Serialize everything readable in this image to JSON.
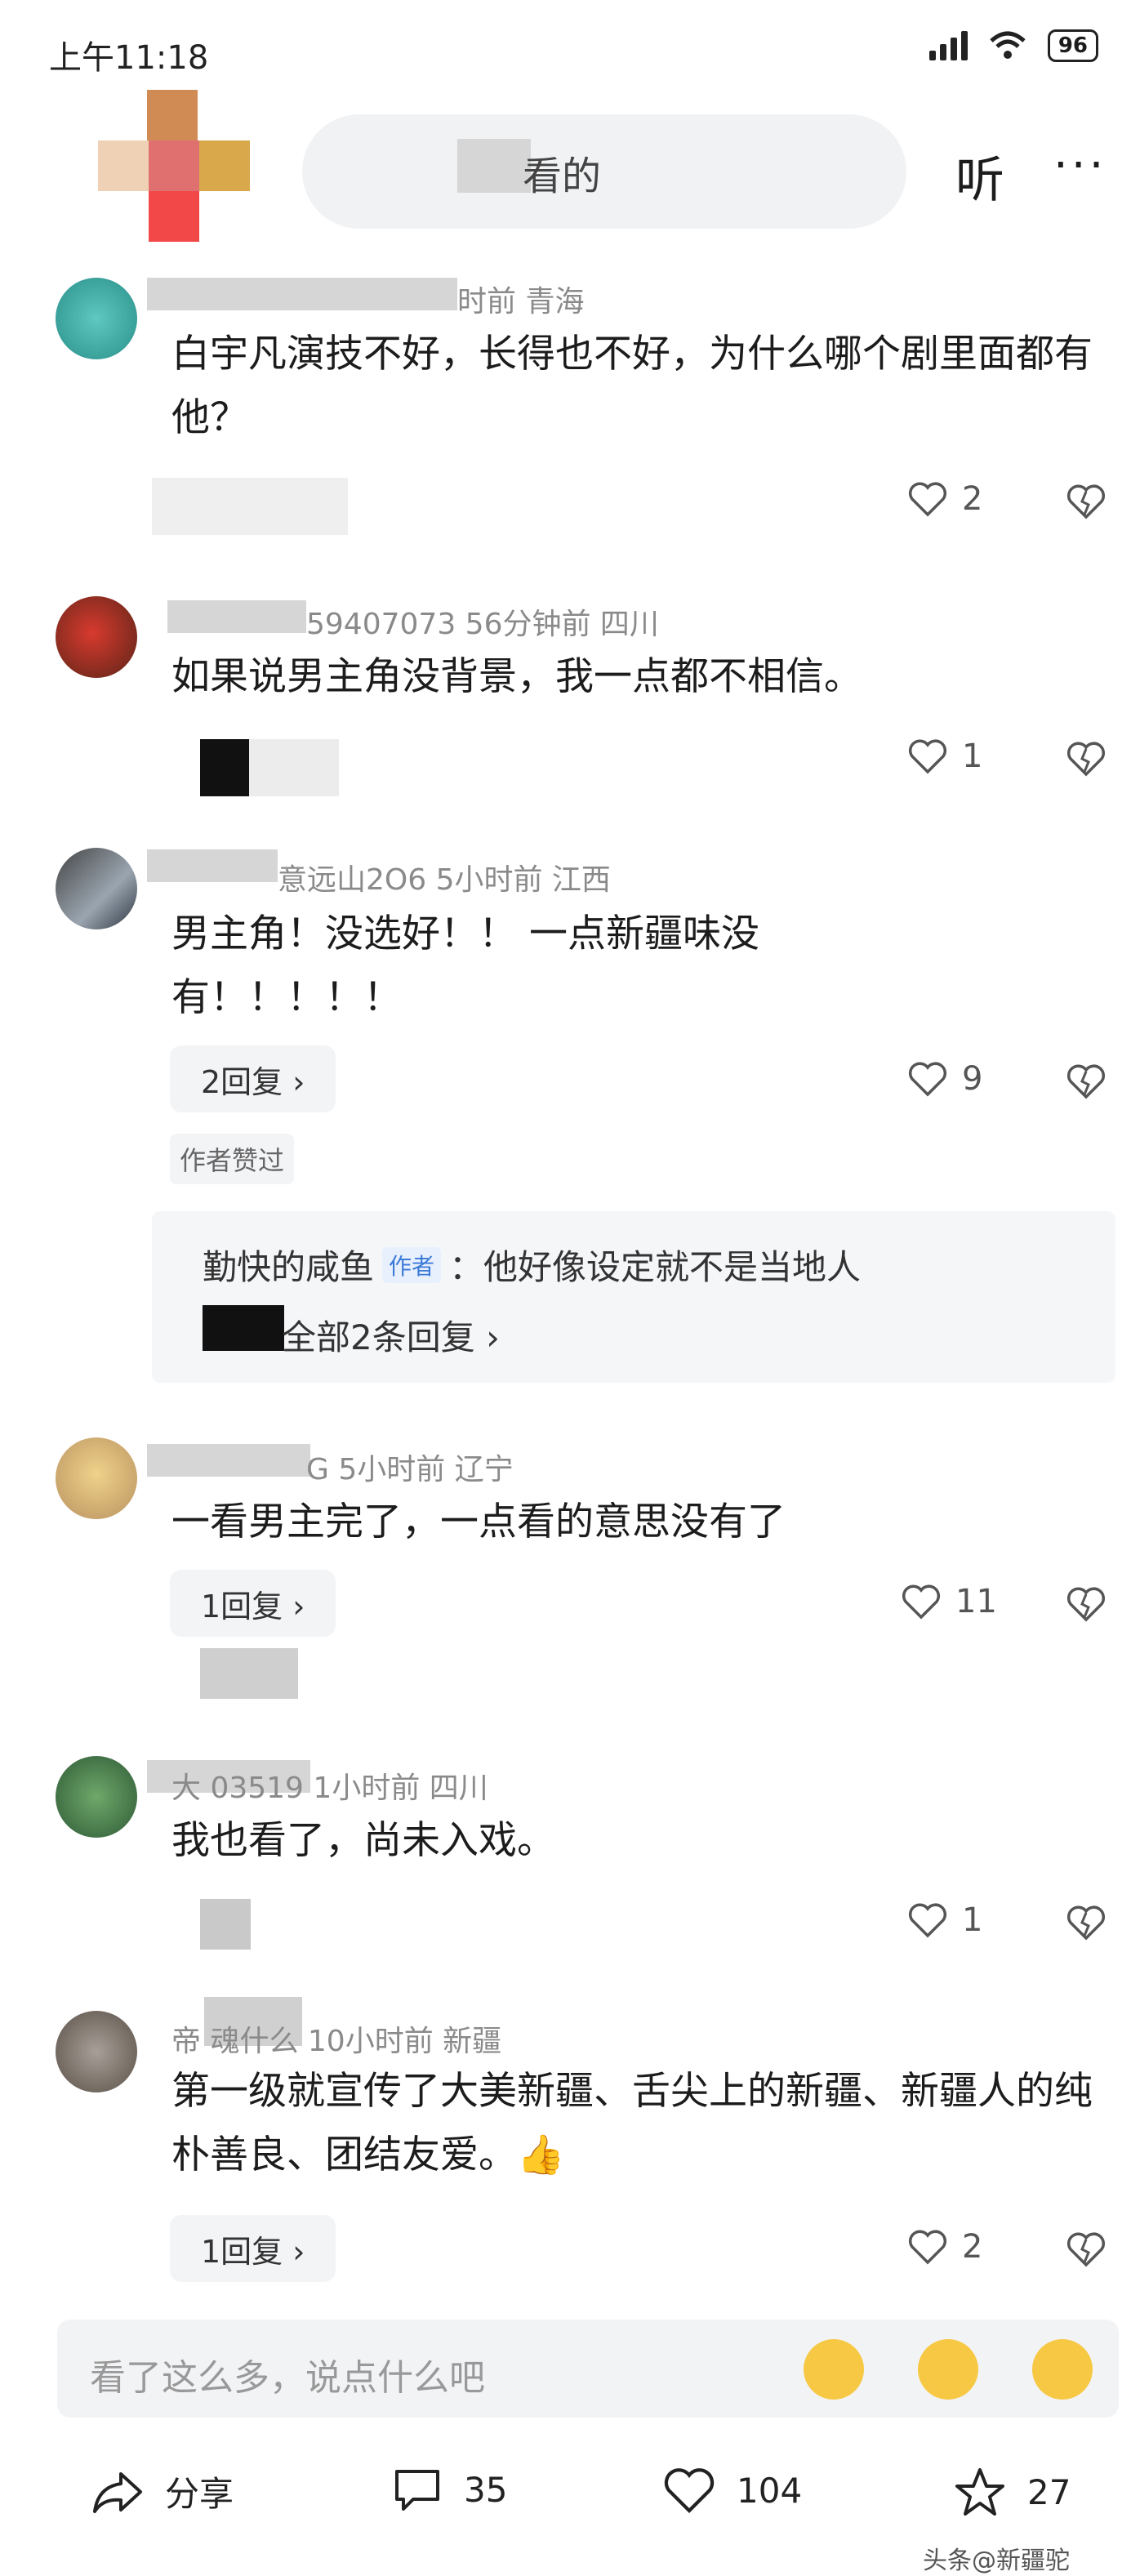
{
  "status_bar": {
    "time": "上午11:18",
    "battery": "96"
  },
  "header": {
    "search_text": "看的",
    "listen_label": "听",
    "more_label": "···"
  },
  "comments": [
    {
      "meta": "时前  青海",
      "text": "白宇凡演技不好，长得也不好，为什么哪个剧里面都有他？",
      "likes": "2"
    },
    {
      "meta": "59407073  56分钟前  四川",
      "text": "如果说男主角没背景，我一点都不相信。",
      "likes": "1"
    },
    {
      "meta": "意远山2O6  5小时前  江西",
      "text": "男主角！没选好！！ 一点新疆味没有！！！！！",
      "likes": "9",
      "reply_button": "2回复 ›",
      "badge": "作者赞过",
      "author_reply": {
        "name": "勤快的咸鱼",
        "tag": "作者",
        "text": "：他好像设定就不是当地人",
        "expand": "全部2条回复 ›"
      }
    },
    {
      "meta": "G  5小时前  辽宁",
      "text": "一看男主完了，一点看的意思没有了",
      "likes": "11",
      "reply_button": "1回复 ›"
    },
    {
      "meta": "大  03519  1小时前  四川",
      "text": "我也看了，尚未入戏。",
      "likes": "1"
    },
    {
      "meta": "帝  魂什么  10小时前  新疆",
      "text": "第一级就宣传了大美新疆、舌尖上的新疆、新疆人的纯朴善良、团结友爱。👍",
      "likes": "2",
      "reply_button": "1回复 ›"
    }
  ],
  "input": {
    "placeholder": "看了这么多，说点什么吧"
  },
  "bottom_bar": {
    "share": "分享",
    "comments": "35",
    "likes": "104",
    "favorites": "27"
  },
  "watermark": "头条@新疆驼",
  "colors": {
    "accent_blue": "#3b7ad8",
    "emoji_yellow": "#f7c843"
  }
}
